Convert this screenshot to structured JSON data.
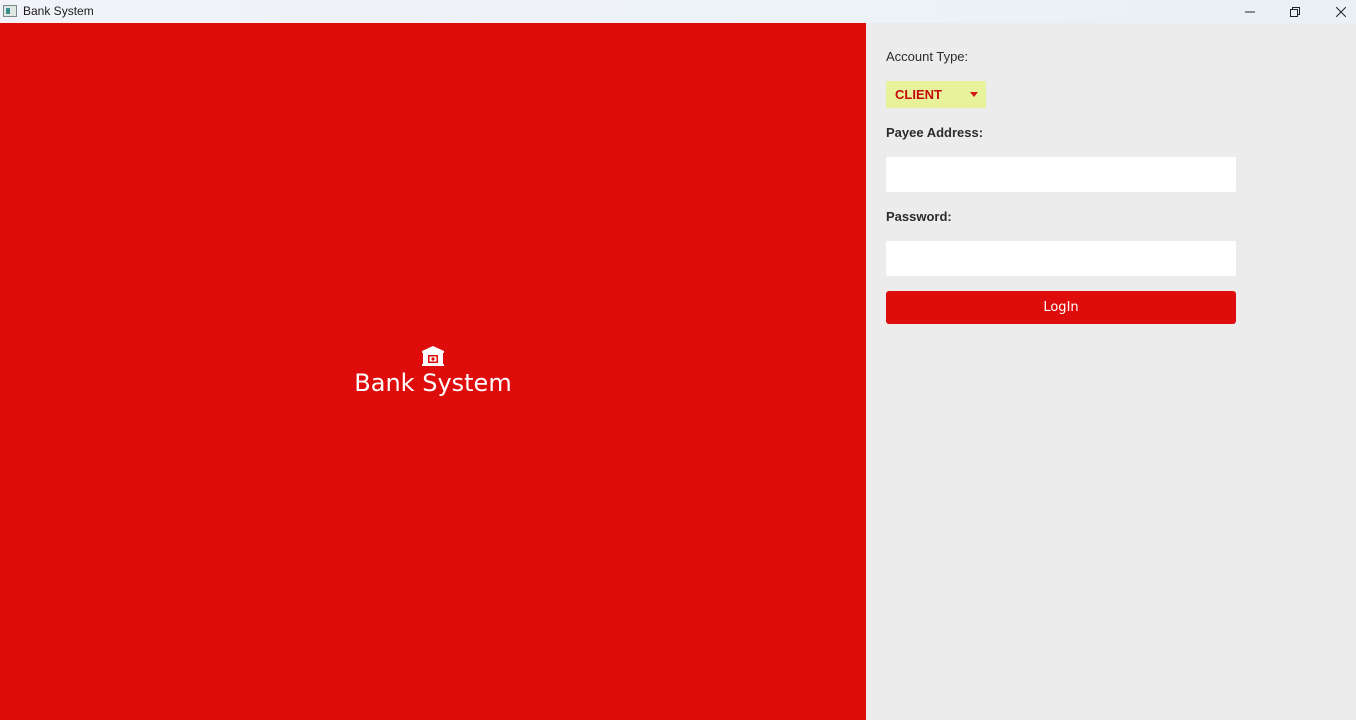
{
  "window": {
    "title": "Bank System",
    "icon": "app-window-icon",
    "controls": [
      "minimize-icon",
      "maximize-icon",
      "close-icon"
    ]
  },
  "brand": {
    "icon": "bank-building-icon",
    "title": "Bank System"
  },
  "form": {
    "account_type_label": "Account Type:",
    "account_type_value": "CLIENT",
    "payee_label": "Payee Address:",
    "payee_value": "",
    "password_label": "Password:",
    "password_value": "",
    "login_label": "LogIn"
  },
  "colors": {
    "brand_red": "#de0c0a",
    "panel_gray": "#ececec",
    "select_bg": "#e8f29a",
    "select_text": "#c4090b"
  }
}
